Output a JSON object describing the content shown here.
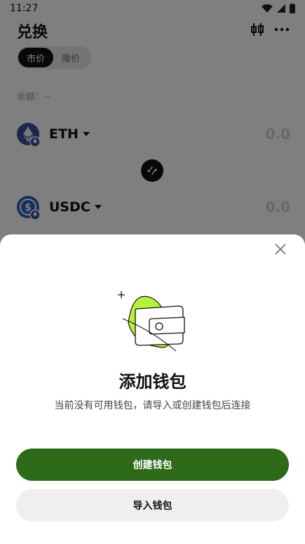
{
  "status_bar": {
    "time": "11:27"
  },
  "header": {
    "title": "兑换"
  },
  "mode_tabs": [
    {
      "label": "市价",
      "active": true
    },
    {
      "label": "限价",
      "active": false
    }
  ],
  "balance": {
    "label": "余额：--"
  },
  "tokens": [
    {
      "symbol": "ETH",
      "amount": "0.0",
      "icon": "eth-icon"
    },
    {
      "symbol": "USDC",
      "amount": "0.0",
      "icon": "usdc-icon"
    }
  ],
  "sheet": {
    "title": "添加钱包",
    "subtitle": "当前没有可用钱包，请导入或创建钱包后连接",
    "create_label": "创建钱包",
    "import_label": "导入钱包"
  },
  "colors": {
    "primary": "#2d6a19",
    "accent_green": "#b6f23c",
    "eth": "#3b4f9c",
    "usdc": "#2b61b8"
  }
}
